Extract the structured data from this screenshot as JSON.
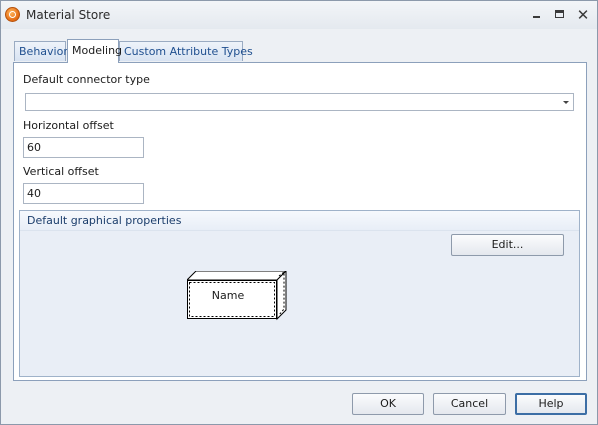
{
  "window": {
    "title": "Material Store",
    "controls": {
      "minimize": "minimize",
      "maximize": "maximize",
      "close": "✕"
    }
  },
  "tabs": [
    {
      "label": "Behavior",
      "active": false
    },
    {
      "label": "Modeling",
      "active": true
    },
    {
      "label": "Custom Attribute Types",
      "active": false
    }
  ],
  "modeling": {
    "connector_type": {
      "label": "Default connector type",
      "value": ""
    },
    "horizontal_offset": {
      "label": "Horizontal offset",
      "value": "60"
    },
    "vertical_offset": {
      "label": "Vertical offset",
      "value": "40"
    },
    "graphical_properties": {
      "title": "Default graphical properties",
      "edit_label": "Edit...",
      "preview_label": "Name"
    }
  },
  "footer": {
    "ok_label": "OK",
    "cancel_label": "Cancel",
    "help_label": "Help"
  },
  "colors": {
    "accent": "#3c6ea5",
    "tab_text": "#1f4f8f",
    "group_background": "#e9eef6"
  }
}
